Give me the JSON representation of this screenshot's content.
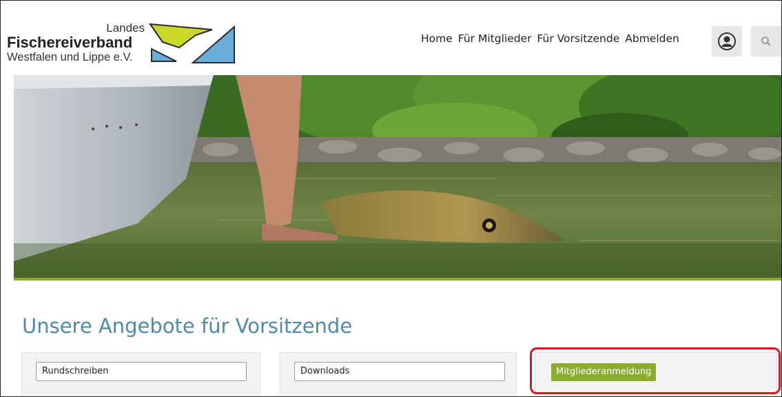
{
  "logo": {
    "line1": "Landes",
    "line2": "Fischereiverband",
    "line3": "Westfalen und Lippe e.V."
  },
  "nav": {
    "items": [
      {
        "label": "Home"
      },
      {
        "label": "Für Mitglieder"
      },
      {
        "label": "Für Vorsitzende"
      },
      {
        "label": "Abmelden"
      }
    ]
  },
  "icons": {
    "user": "user-icon",
    "search": "search-icon"
  },
  "colors": {
    "accent_green": "#8aad2b",
    "title_blue": "#4f8aa8",
    "highlight_red": "#e0151e"
  },
  "main": {
    "title": "Unsere Angebote für Vorsitzende",
    "cards": [
      {
        "label": "Rundschreiben"
      },
      {
        "label": "Downloads"
      },
      {
        "label": "Mitgliederanmeldung"
      }
    ]
  }
}
